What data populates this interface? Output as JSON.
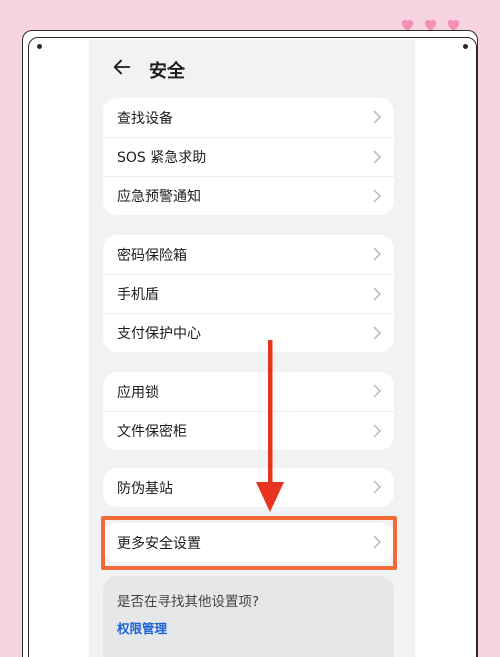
{
  "page": {
    "title": "安全",
    "back_icon": "back-arrow-icon"
  },
  "groups": [
    {
      "items": [
        {
          "label": "查找设备"
        },
        {
          "label": "SOS 紧急求助"
        },
        {
          "label": "应急预警通知"
        }
      ]
    },
    {
      "items": [
        {
          "label": "密码保险箱"
        },
        {
          "label": "手机盾"
        },
        {
          "label": "支付保护中心"
        }
      ]
    },
    {
      "items": [
        {
          "label": "应用锁"
        },
        {
          "label": "文件保密柜"
        }
      ]
    },
    {
      "items": [
        {
          "label": "防伪基站"
        }
      ]
    },
    {
      "items": [
        {
          "label": "更多安全设置"
        }
      ]
    }
  ],
  "suggest": {
    "question": "是否在寻找其他设置项?",
    "link": "权限管理"
  },
  "colors": {
    "background": "#f8d4e2",
    "heart": "#f48fb5",
    "highlight": "#f26a37",
    "arrow": "#e8341f",
    "link": "#1c63d6"
  },
  "icons": {
    "hearts": [
      "heart-icon",
      "heart-icon",
      "heart-icon"
    ],
    "chevron": "chevron-right-icon",
    "pointer": "down-arrow-icon"
  }
}
